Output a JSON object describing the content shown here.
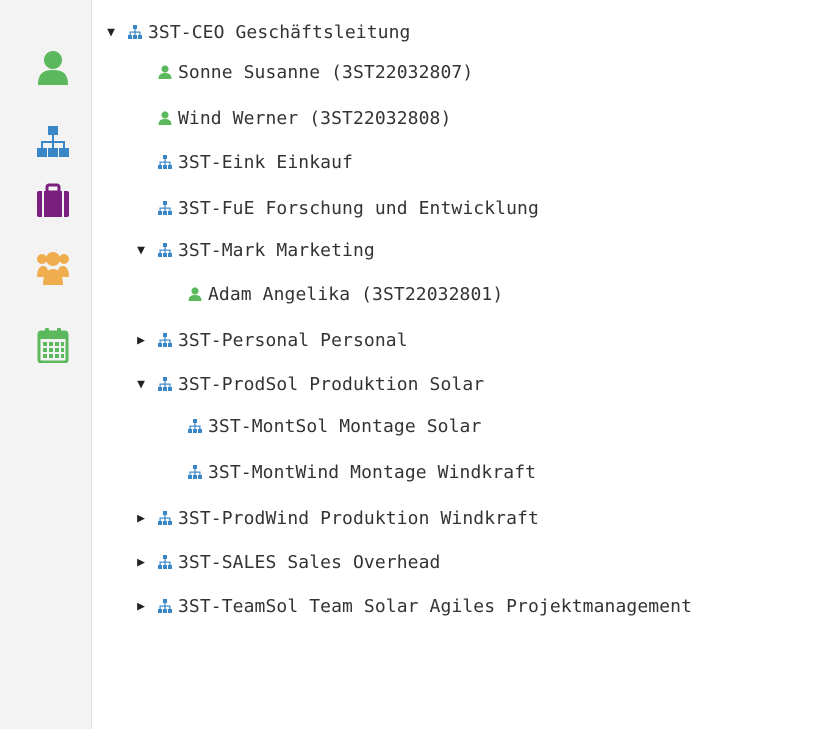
{
  "colors": {
    "user_green": "#5cb85c",
    "org_blue": "#3a87c8",
    "briefcase_purple": "#7a1f7e",
    "group_orange": "#f0ad4e",
    "calendar_green": "#5cb85c"
  },
  "sidebar": {
    "icons": [
      {
        "name": "user-icon"
      },
      {
        "name": "org-chart-icon"
      },
      {
        "name": "briefcase-icon"
      },
      {
        "name": "group-icon"
      },
      {
        "name": "calendar-icon"
      }
    ]
  },
  "tree": {
    "nodes": [
      {
        "label": "3ST-CEO Geschäftsleitung",
        "type": "org",
        "toggle": "▼"
      },
      {
        "label": "Sonne Susanne (3ST22032807)",
        "type": "person",
        "toggle": ""
      },
      {
        "label": "Wind Werner (3ST22032808)",
        "type": "person",
        "toggle": ""
      },
      {
        "label": "3ST-Eink Einkauf",
        "type": "org",
        "toggle": ""
      },
      {
        "label": "3ST-FuE Forschung und Entwicklung",
        "type": "org",
        "toggle": ""
      },
      {
        "label": "3ST-Mark Marketing",
        "type": "org",
        "toggle": "▼"
      },
      {
        "label": "Adam Angelika (3ST22032801)",
        "type": "person",
        "toggle": ""
      },
      {
        "label": "3ST-Personal Personal",
        "type": "org",
        "toggle": "▶"
      },
      {
        "label": "3ST-ProdSol Produktion Solar",
        "type": "org",
        "toggle": "▼"
      },
      {
        "label": "3ST-MontSol Montage Solar",
        "type": "org",
        "toggle": ""
      },
      {
        "label": "3ST-MontWind Montage Windkraft",
        "type": "org",
        "toggle": ""
      },
      {
        "label": "3ST-ProdWind Produktion Windkraft",
        "type": "org",
        "toggle": "▶"
      },
      {
        "label": "3ST-SALES Sales Overhead",
        "type": "org",
        "toggle": "▶"
      },
      {
        "label": "3ST-TeamSol Team Solar Agiles Projektmanagement",
        "type": "org",
        "toggle": "▶"
      }
    ]
  }
}
